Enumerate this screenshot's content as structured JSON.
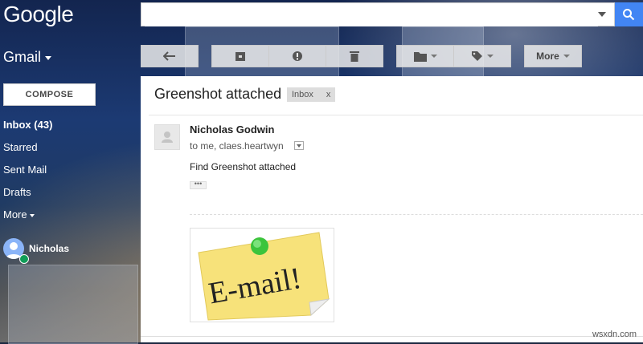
{
  "header": {
    "logo": "Google",
    "search": {
      "value": "",
      "placeholder": ""
    }
  },
  "app": {
    "name": "Gmail"
  },
  "toolbar": {
    "more_label": "More"
  },
  "sidebar": {
    "compose": "COMPOSE",
    "items": [
      {
        "label": "Inbox (43)"
      },
      {
        "label": "Starred"
      },
      {
        "label": "Sent Mail"
      },
      {
        "label": "Drafts"
      },
      {
        "label": "More"
      }
    ],
    "chat": {
      "name": "Nicholas"
    }
  },
  "message": {
    "subject": "Greenshot attached",
    "label": "Inbox",
    "label_remove": "x",
    "sender": "Nicholas Godwin",
    "recipients": "to me, claes.heartwyn",
    "body": "Find Greenshot attached",
    "trimmed": "•••",
    "attachment_text": "E-mail!"
  },
  "watermark": "wsxdn.com",
  "colors": {
    "search_button": "#4285f4",
    "presence": "#0f9d58",
    "sticky_note": "#f7e27a",
    "pin": "#3cc43c"
  }
}
